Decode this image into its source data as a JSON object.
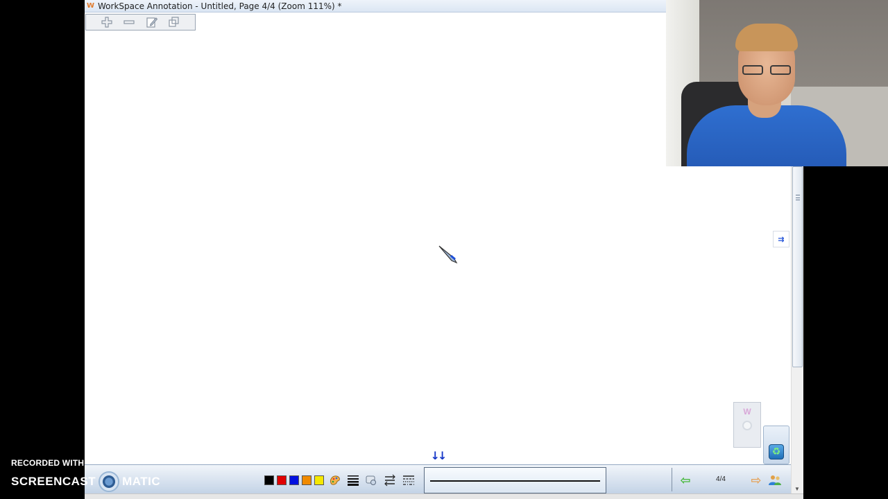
{
  "window": {
    "logo": "W",
    "title": "WorkSpace Annotation - Untitled, Page 4/4  (Zoom 111%) *"
  },
  "zoom_toolbar": {
    "icons": [
      "zoom-in-icon",
      "zoom-out-icon",
      "edit-page-icon",
      "copy-pages-icon"
    ]
  },
  "colors": {
    "black": "#000000",
    "red": "#e00000",
    "blue": "#0010e0",
    "orange": "#f08a00",
    "yellow": "#f5e800"
  },
  "bottom_toolbar": {
    "page_count": "4/4",
    "pen_preview_color": "#111111"
  },
  "right_panel": {
    "w_widget_letter": "W"
  },
  "watermark": {
    "line1": "RECORDED WITH",
    "line2_part1": "SCREENCAST",
    "line2_part2": "MATIC"
  }
}
